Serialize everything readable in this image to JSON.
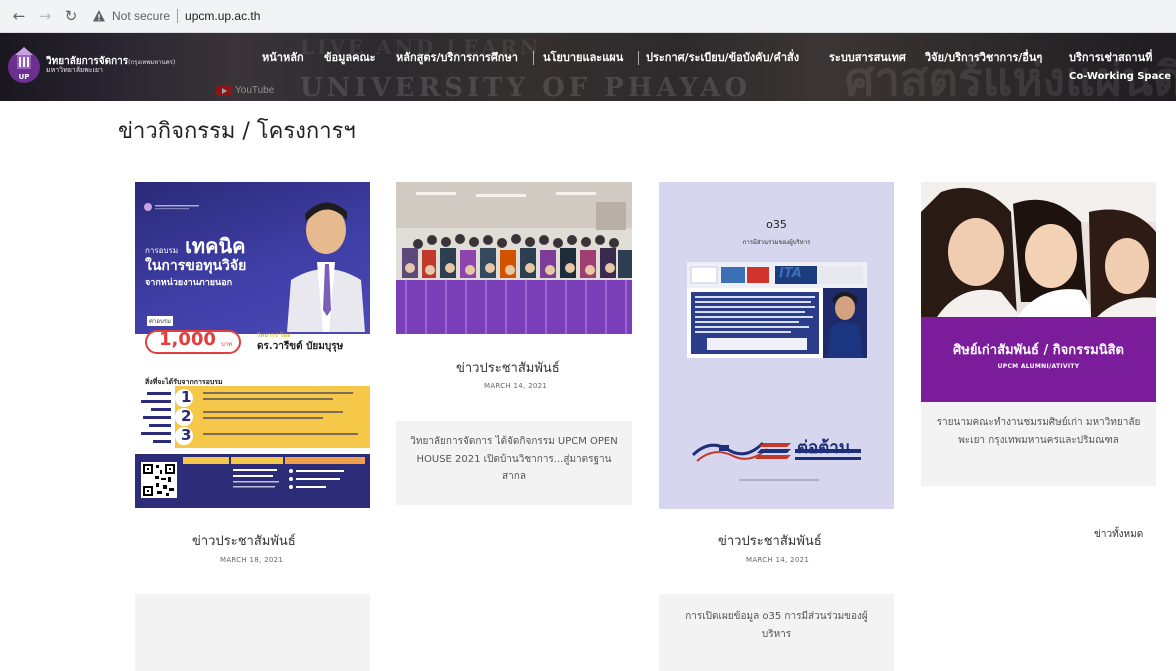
{
  "browser": {
    "not_secure": "Not secure",
    "url": "upcm.up.ac.th"
  },
  "header": {
    "logo_line1": "วิทยาลัยการจัดการ",
    "logo_line1_small": "(กรุงเทพมหานคร)",
    "logo_line2": "มหาวิทยาลัยพะเยา",
    "bg_text": "UNIVERSITY OF PHAYAO",
    "bg_text_top": "LIVE AND LEARN",
    "bg_thai": "ศาสตร์แห่งแผ่นดิน",
    "youtube_label": "YouTube",
    "nav": [
      {
        "label": "หน้าหลัก"
      },
      {
        "label": "ข้อมูลคณะ"
      },
      {
        "label": "หลักสูตร/บริการการศึกษา"
      },
      {
        "label": "นโยบายและแผน"
      },
      {
        "label": "ประกาศ/ระเบียบ/ข้อบังคับ/คำสั่ง"
      },
      {
        "label": "ระบบสารสนเทศ"
      },
      {
        "label": "วิจัย/บริการวิชาการ/อื่นๆ"
      },
      {
        "label": "บริการเช่าสถานที่",
        "sub": "Co-Working Space"
      }
    ]
  },
  "section": {
    "title": "ข่าวกิจกรรม / โครงการฯ",
    "all_news": "ข่าวทั้งหมด"
  },
  "cards": [
    {
      "title": "ข่าวประชาสัมพันธ์",
      "date": "MARCH 18, 2021",
      "poster": {
        "prefix": "การอบรม",
        "h1": "เทคนิค",
        "h2": "ในการขอทุนวิจัย",
        "h3": "จากหน่วยงานภายนอก",
        "price_label": "ค่าอบรม",
        "price": "1,000",
        "price_unit": "บาท",
        "speaker_label": "วิทยากร โดย",
        "speaker": "ดร.วารีขต์ บัยมบุรุษ",
        "benefit_title": "สิ่งที่จะได้รับจากการอบรม",
        "numbers": [
          "1",
          "2",
          "3"
        ]
      }
    },
    {
      "title": "ข่าวประชาสัมพันธ์",
      "date": "MARCH 14, 2021",
      "excerpt": "วิทยาลัยการจัดการ ได้จัดกิจกรรม UPCM OPEN HOUSE 2021 เปิดบ้านวิชาการ...สู่มาตรฐานสากล"
    },
    {
      "title": "ข่าวประชาสัมพันธ์",
      "date": "MARCH 14, 2021",
      "excerpt": "การเปิดเผยข้อมูล o35 การมีส่วนร่วมของผู้บริหาร",
      "doc": {
        "code": "o35",
        "subtitle": "การมีส่วนร่วมของผู้บริหาร",
        "ita": "ITA",
        "bottom_text": "ต่อต้าน"
      }
    },
    {
      "banner_title": "ศิษย์เก่าสัมพันธ์ / กิจกรรมนิสิต",
      "banner_sub": "UPCM ALUMNI/ATIVITY",
      "excerpt": "รายนามคณะทำงานชมรมศิษย์เก่า มหาวิทยาลัยพะเยา กรุงเทพมหานครและปริมณฑล"
    }
  ],
  "colors": {
    "poster_blue": "#3f3ea6",
    "poster_red": "#e23e3e",
    "poster_yellow": "#f5c84a",
    "banner_purple": "#7b1d9a",
    "excerpt_bg": "#f3f3f3"
  }
}
